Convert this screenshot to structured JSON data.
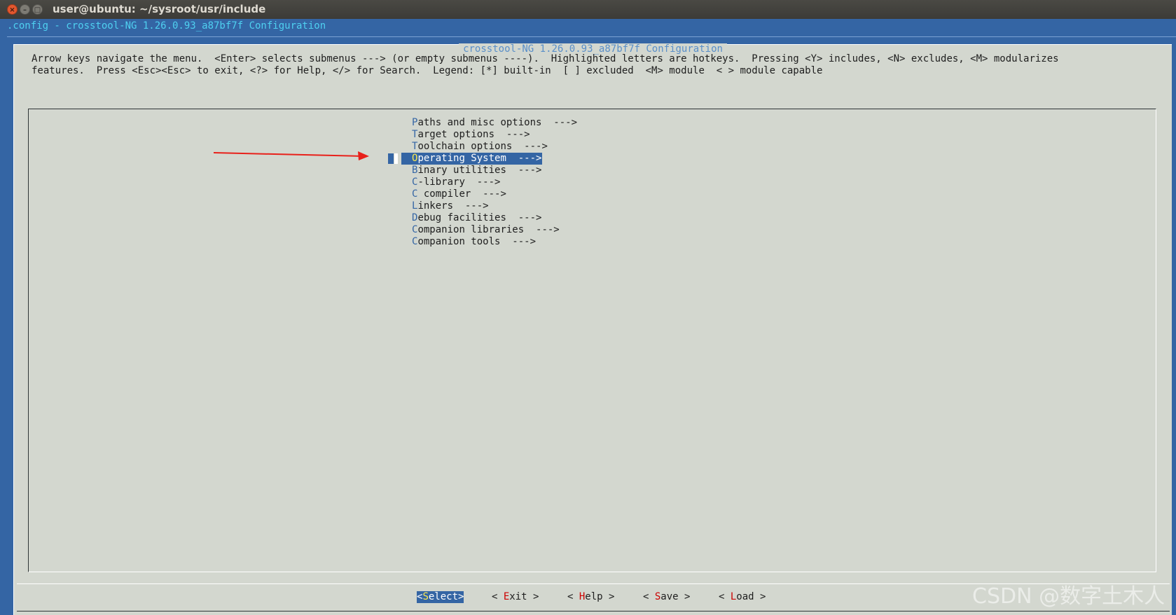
{
  "window": {
    "title": "user@ubuntu: ~/sysroot/usr/include",
    "close_glyph": "×",
    "min_glyph": "–",
    "max_glyph": "□"
  },
  "terminal": {
    "header": ".config - crosstool-NG 1.26.0.93_a87bf7f Configuration"
  },
  "dialog": {
    "title": "crosstool-NG 1.26.0.93_a87bf7f Configuration",
    "help_line1": "Arrow keys navigate the menu.  <Enter> selects submenus ---> (or empty submenus ----).  Highlighted letters are hotkeys.  Pressing <Y> includes, <N> excludes, <M> modularizes",
    "help_line2": "features.  Press <Esc><Esc> to exit, <?> for Help, </> for Search.  Legend: [*] built-in  [ ] excluded  <M> module  < > module capable"
  },
  "menu": {
    "items": [
      {
        "hotkey": "P",
        "rest": "aths and misc options  --->"
      },
      {
        "hotkey": "T",
        "rest": "arget options  --->"
      },
      {
        "hotkey": "T",
        "rest": "oolchain options  --->"
      },
      {
        "hotkey": "O",
        "rest": "perating System  --->",
        "selected": true
      },
      {
        "hotkey": "B",
        "rest": "inary utilities  --->"
      },
      {
        "hotkey": "C",
        "rest": "-library  --->"
      },
      {
        "hotkey": "C",
        "rest": " compiler  --->"
      },
      {
        "hotkey": "L",
        "rest": "inkers  --->"
      },
      {
        "hotkey": "D",
        "rest": "ebug facilities  --->"
      },
      {
        "hotkey": "C",
        "rest": "ompanion libraries  --->"
      },
      {
        "hotkey": "C",
        "rest": "ompanion tools  --->"
      }
    ]
  },
  "buttons": {
    "select": {
      "pre": "<",
      "hotkey": "S",
      "post": "elect>"
    },
    "exit": {
      "pre": "< ",
      "hotkey": "E",
      "post": "xit >"
    },
    "help": {
      "pre": "< ",
      "hotkey": "H",
      "post": "elp >"
    },
    "save": {
      "pre": "< ",
      "hotkey": "S",
      "post": "ave >"
    },
    "load": {
      "pre": "< ",
      "hotkey": "L",
      "post": "oad >"
    }
  },
  "watermark": "CSDN @数字土木人",
  "colors": {
    "terminal_bg": "#3465a4",
    "dialog_bg": "#d3d7cf",
    "highlight": "#3465a4",
    "hotkey_menu": "#3465a4",
    "hotkey_button": "#cc0000",
    "annotation_arrow": "#e8201a"
  }
}
